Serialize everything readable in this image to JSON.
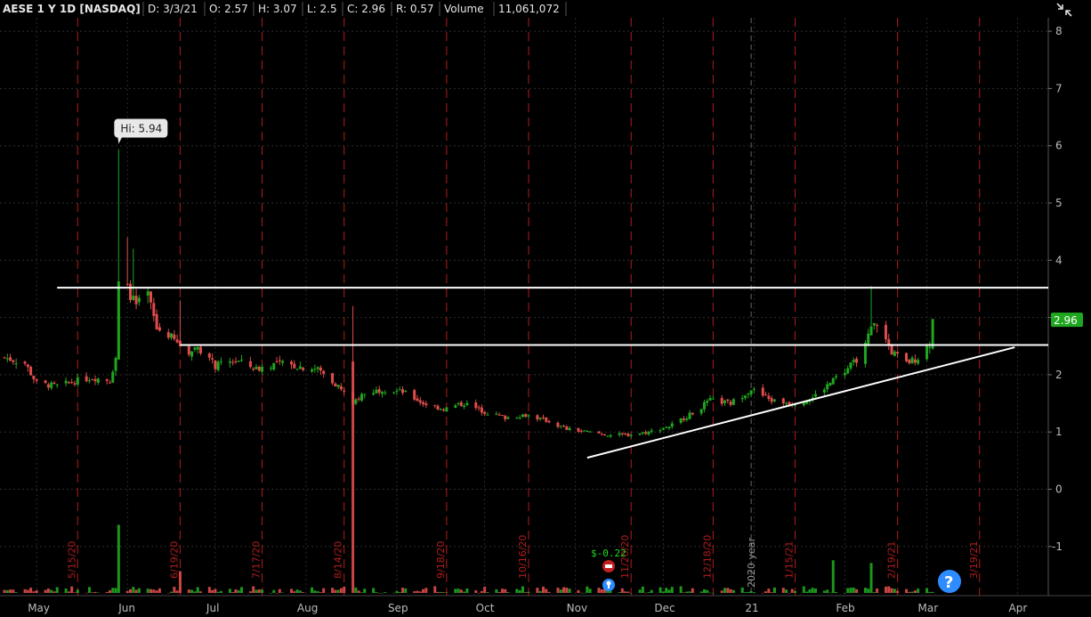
{
  "header": {
    "symbol": "AESE 1 Y 1D [NASDAQ]",
    "date": "D: 3/3/21",
    "open": "O: 2.57",
    "high": "H: 3.07",
    "low": "L: 2.5",
    "close": "C: 2.96",
    "range": "R: 0.57",
    "volume_label": "Volume",
    "volume_value": "11,061,072"
  },
  "colors": {
    "up": "#1fa71f",
    "down": "#e04b4b",
    "bg": "#000000",
    "line": "#ffffff",
    "badge": "#1fa71f",
    "event": "#c21f1f",
    "question": "#2d8cff"
  },
  "chart_data": {
    "type": "candlestick",
    "title": "AESE 1 Y 1D [NASDAQ]",
    "y_ticks": [
      "8",
      "7",
      "6",
      "5",
      "4",
      "3",
      "2",
      "1",
      "0",
      "-1"
    ],
    "ylim": [
      -1.9,
      8.4
    ],
    "x_months": [
      "May",
      "Jun",
      "Jul",
      "Aug",
      "Sep",
      "Oct",
      "Nov",
      "Dec",
      "21",
      "Feb",
      "Mar",
      "Apr"
    ],
    "event_dates": [
      "5/15/20",
      "6/19/20",
      "7/17/20",
      "8/14/20",
      "9/18/20",
      "10/16/20",
      "11/20/20",
      "12/18/20",
      "1/15/21",
      "2/19/21",
      "3/19/21"
    ],
    "year_marker": "2020 year",
    "last_price": "2.96",
    "high_callout": "Hi: 5.94",
    "high_value": 5.94,
    "earnings_label": "$-0.22",
    "question_icon": "?",
    "collapse_icon": "collapse-icon",
    "price_path": [
      [
        "2020-04-20",
        2.3
      ],
      [
        "2020-04-27",
        2.2
      ],
      [
        "2020-05-01",
        1.85
      ],
      [
        "2020-05-08",
        1.8
      ],
      [
        "2020-05-15",
        1.9
      ],
      [
        "2020-05-20",
        1.95
      ],
      [
        "2020-05-26",
        1.9
      ],
      [
        "2020-05-28",
        2.3
      ],
      [
        "2020-05-29",
        3.6
      ],
      [
        "2020-06-01",
        3.5
      ],
      [
        "2020-06-04",
        3.2
      ],
      [
        "2020-06-08",
        3.4
      ],
      [
        "2020-06-11",
        2.8
      ],
      [
        "2020-06-15",
        2.7
      ],
      [
        "2020-06-18",
        2.55
      ],
      [
        "2020-06-22",
        2.4
      ],
      [
        "2020-06-25",
        2.5
      ],
      [
        "2020-07-01",
        2.15
      ],
      [
        "2020-07-08",
        2.25
      ],
      [
        "2020-07-15",
        2.1
      ],
      [
        "2020-07-22",
        2.2
      ],
      [
        "2020-07-29",
        2.15
      ],
      [
        "2020-08-05",
        2.1
      ],
      [
        "2020-08-12",
        1.8
      ],
      [
        "2020-08-17",
        1.5
      ],
      [
        "2020-08-20",
        1.65
      ],
      [
        "2020-08-27",
        1.75
      ],
      [
        "2020-09-03",
        1.7
      ],
      [
        "2020-09-10",
        1.5
      ],
      [
        "2020-09-17",
        1.4
      ],
      [
        "2020-09-24",
        1.5
      ],
      [
        "2020-10-01",
        1.35
      ],
      [
        "2020-10-08",
        1.25
      ],
      [
        "2020-10-15",
        1.3
      ],
      [
        "2020-10-22",
        1.2
      ],
      [
        "2020-10-29",
        1.05
      ],
      [
        "2020-11-05",
        1.0
      ],
      [
        "2020-11-12",
        0.95
      ],
      [
        "2020-11-19",
        0.95
      ],
      [
        "2020-11-26",
        1.0
      ],
      [
        "2020-12-03",
        1.1
      ],
      [
        "2020-12-10",
        1.3
      ],
      [
        "2020-12-17",
        1.55
      ],
      [
        "2020-12-24",
        1.5
      ],
      [
        "2020-12-31",
        1.75
      ],
      [
        "2021-01-07",
        1.55
      ],
      [
        "2021-01-14",
        1.5
      ],
      [
        "2021-01-21",
        1.6
      ],
      [
        "2021-01-28",
        1.9
      ],
      [
        "2021-02-04",
        2.2
      ],
      [
        "2021-02-08",
        2.5
      ],
      [
        "2021-02-10",
        2.8
      ],
      [
        "2021-02-12",
        2.9
      ],
      [
        "2021-02-17",
        2.4
      ],
      [
        "2021-02-22",
        2.2
      ],
      [
        "2021-02-26",
        2.3
      ],
      [
        "2021-03-02",
        2.55
      ],
      [
        "2021-03-03",
        2.96
      ]
    ],
    "high_spikes": [
      [
        "2020-05-29",
        5.94
      ],
      [
        "2020-06-01",
        4.4
      ],
      [
        "2020-06-03",
        4.2
      ],
      [
        "2020-06-19",
        3.3
      ],
      [
        "2020-08-17",
        3.2
      ],
      [
        "2021-02-10",
        3.55
      ]
    ],
    "volume_spikes": [
      [
        "2020-05-29",
        0.25
      ],
      [
        "2020-06-19",
        0.08
      ],
      [
        "2020-08-17",
        0.85
      ],
      [
        "2021-01-28",
        0.12
      ],
      [
        "2021-02-10",
        0.11
      ]
    ],
    "horizontal_levels": [
      3.52,
      2.52
    ],
    "trendline": {
      "x": [
        "2020-11-05",
        "2021-03-31"
      ],
      "y": [
        0.55,
        2.48
      ]
    }
  }
}
